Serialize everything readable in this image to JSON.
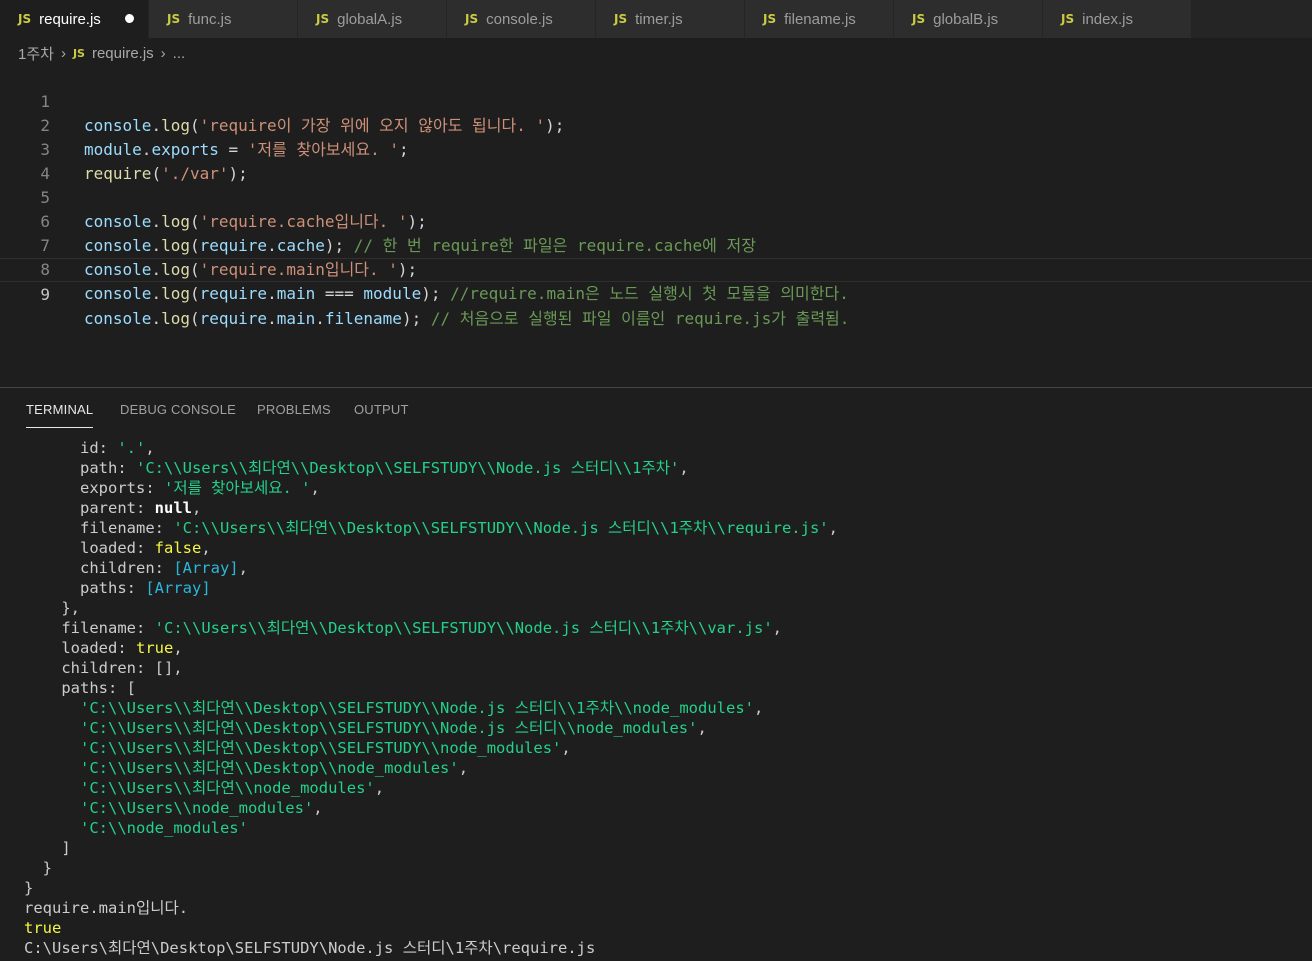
{
  "tabs": [
    {
      "label": "require.js",
      "icon": "JS"
    },
    {
      "label": "func.js",
      "icon": "JS"
    },
    {
      "label": "globalA.js",
      "icon": "JS"
    },
    {
      "label": "console.js",
      "icon": "JS"
    },
    {
      "label": "timer.js",
      "icon": "JS"
    },
    {
      "label": "filename.js",
      "icon": "JS"
    },
    {
      "label": "globalB.js",
      "icon": "JS"
    },
    {
      "label": "index.js",
      "icon": "JS"
    }
  ],
  "breadcrumb": {
    "folder": "1주차",
    "icon": "JS",
    "file": "require.js",
    "more": "..."
  },
  "editor": {
    "line_numbers": [
      "1",
      "2",
      "3",
      "4",
      "5",
      "6",
      "7",
      "8",
      "9"
    ],
    "l1": [
      "console",
      ".",
      "log",
      "(",
      "'require이 가장 위에 오지 않아도 됩니다. '",
      ");"
    ],
    "l2": [
      "module",
      ".",
      "exports",
      " = ",
      "'저를 찾아보세요. '",
      ";"
    ],
    "l3": [
      "require",
      "(",
      "'./var'",
      ");"
    ],
    "l5": [
      "console",
      ".",
      "log",
      "(",
      "'require.cache입니다. '",
      ");"
    ],
    "l6": [
      "console",
      ".",
      "log",
      "(",
      "require",
      ".",
      "cache",
      "); ",
      "// 한 번 require한 파일은 require.cache에 저장"
    ],
    "l7": [
      "console",
      ".",
      "log",
      "(",
      "'require.main입니다. '",
      ");"
    ],
    "l8": [
      "console",
      ".",
      "log",
      "(",
      "require",
      ".",
      "main",
      " === ",
      "module",
      "); ",
      "//require.main은 노드 실행시 첫 모듈을 의미한다."
    ],
    "l9": [
      "console",
      ".",
      "log",
      "(",
      "require",
      ".",
      "main",
      ".",
      "filename",
      "); ",
      "// 처음으로 실행된 파일 이름인 require.js가 출력됨."
    ]
  },
  "panel": {
    "tabs": [
      "TERMINAL",
      "DEBUG CONSOLE",
      "PROBLEMS",
      "OUTPUT"
    ],
    "active": "TERMINAL"
  },
  "terminal": {
    "t1": [
      "      id: ",
      "'.'",
      ","
    ],
    "t2": [
      "      path: ",
      "'C:\\\\Users\\\\최다연\\\\Desktop\\\\SELFSTUDY\\\\Node.js 스터디\\\\1주차'",
      ","
    ],
    "t3": [
      "      exports: ",
      "'저를 찾아보세요. '",
      ","
    ],
    "t4": [
      "      parent: ",
      "null",
      ","
    ],
    "t5": [
      "      filename: ",
      "'C:\\\\Users\\\\최다연\\\\Desktop\\\\SELFSTUDY\\\\Node.js 스터디\\\\1주차\\\\require.js'",
      ","
    ],
    "t6": [
      "      loaded: ",
      "false",
      ","
    ],
    "t7": [
      "      children: ",
      "[Array]",
      ","
    ],
    "t8": [
      "      paths: ",
      "[Array]"
    ],
    "t9": "    },",
    "t10": [
      "    filename: ",
      "'C:\\\\Users\\\\최다연\\\\Desktop\\\\SELFSTUDY\\\\Node.js 스터디\\\\1주차\\\\var.js'",
      ","
    ],
    "t11": [
      "    loaded: ",
      "true",
      ","
    ],
    "t12": "    children: [],",
    "t13": "    paths: [",
    "paths": [
      "'C:\\\\Users\\\\최다연\\\\Desktop\\\\SELFSTUDY\\\\Node.js 스터디\\\\1주차\\\\node_modules'",
      "'C:\\\\Users\\\\최다연\\\\Desktop\\\\SELFSTUDY\\\\Node.js 스터디\\\\node_modules'",
      "'C:\\\\Users\\\\최다연\\\\Desktop\\\\SELFSTUDY\\\\node_modules'",
      "'C:\\\\Users\\\\최다연\\\\Desktop\\\\node_modules'",
      "'C:\\\\Users\\\\최다연\\\\node_modules'",
      "'C:\\\\Users\\\\node_modules'",
      "'C:\\\\node_modules'"
    ],
    "path_indent": "      ",
    "comma": ",",
    "t21": "    ]",
    "t22": "  }",
    "t23": "}",
    "t24": "require.main입니다.",
    "t25": "true",
    "t26": "C:\\Users\\최다연\\Desktop\\SELFSTUDY\\Node.js 스터디\\1주차\\require.js"
  },
  "colors": {
    "editor_bg": "#1e1e1e",
    "string": "#ce9178",
    "comment": "#6a9955",
    "variable": "#9cdcfe",
    "function": "#dcdcaa",
    "terminal_green": "#23d18b",
    "terminal_yellow": "#f5f543",
    "terminal_blue": "#29b8db"
  }
}
